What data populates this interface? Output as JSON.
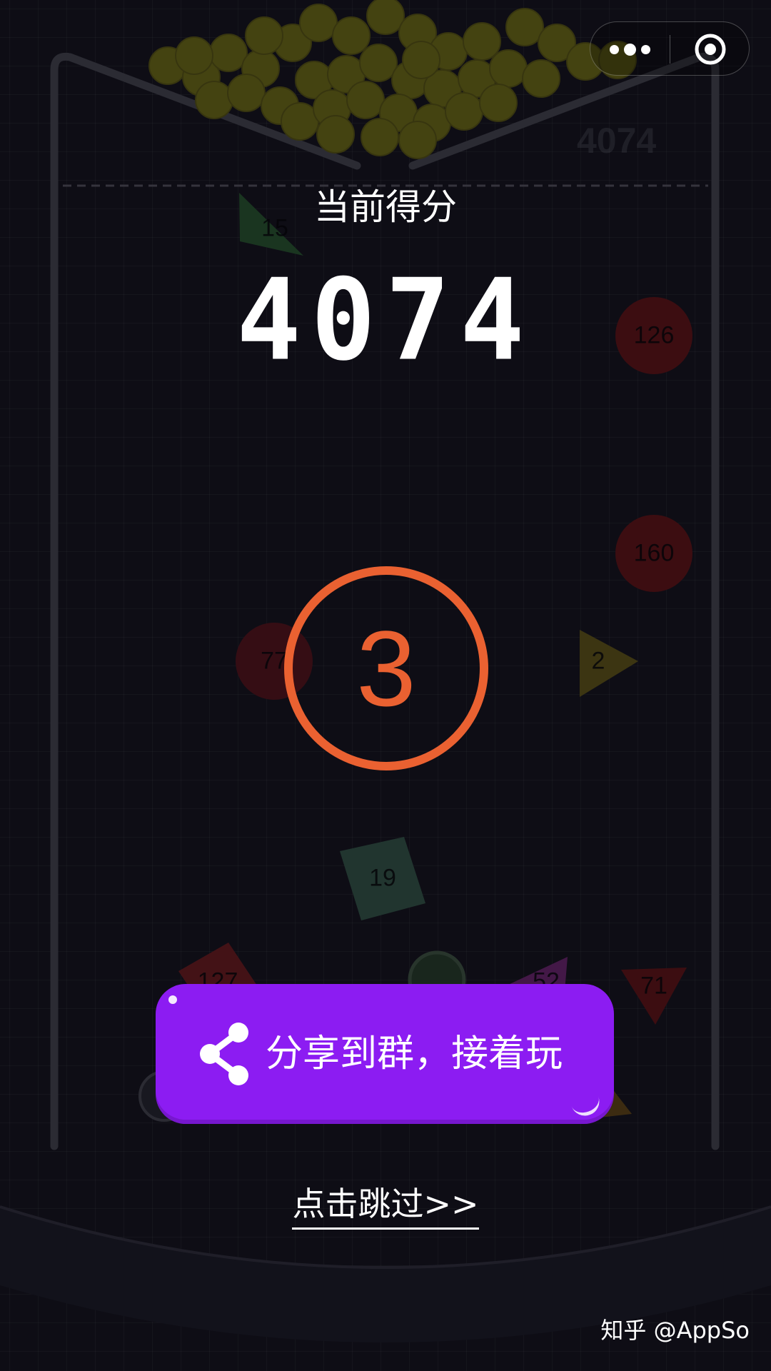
{
  "game": {
    "corner_score": "4074",
    "score_title": "当前得分",
    "score_value": "4074",
    "countdown": "3",
    "share_label": "分享到群，接着玩",
    "skip_label": "点击跳过>>",
    "accent_color": "#ea6131",
    "button_color": "#8c1cf2"
  },
  "obstacles": {
    "triangle_top_left": "15",
    "circle_right_upper": "126",
    "circle_right_middle": "160",
    "circle_left_middle": "77",
    "triangle_right_middle": "2",
    "square_center": "19",
    "square_bottom_left": "127",
    "triangle_bottom_center": "52",
    "triangle_bottom_right": "71"
  },
  "capsule": {
    "more_icon": "more-dots-icon",
    "close_icon": "target-close-icon"
  },
  "watermark": "知乎 @AppSo"
}
